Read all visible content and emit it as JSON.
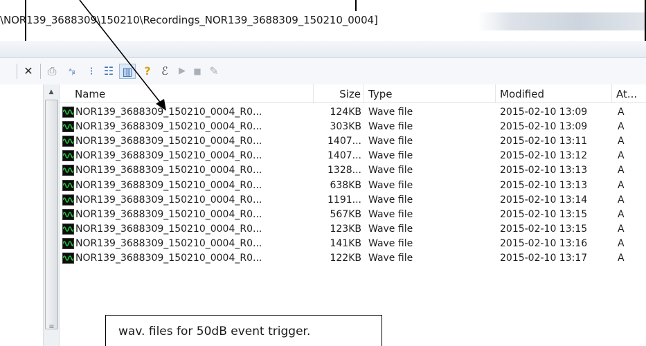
{
  "window": {
    "title_path": "\\NOR139_3688309\\150210\\Recordings_NOR139_3688309_150210_0004]"
  },
  "toolbar": {
    "items": [
      {
        "name": "separator",
        "glyph": "|"
      },
      {
        "name": "delete-icon",
        "glyph": "✕"
      },
      {
        "name": "print-icon",
        "glyph": "⎙"
      },
      {
        "name": "large-icons-view-icon",
        "glyph": "ᵃᵦ"
      },
      {
        "name": "list-view-icon",
        "glyph": "⁝"
      },
      {
        "name": "details-view-icon",
        "glyph": "☷"
      },
      {
        "name": "columns-view-icon",
        "glyph": "▥"
      },
      {
        "name": "help-icon",
        "glyph": "?"
      },
      {
        "name": "find-icon",
        "glyph": "ℰ"
      },
      {
        "name": "play-icon",
        "glyph": "▶"
      },
      {
        "name": "stop-icon",
        "glyph": "■"
      },
      {
        "name": "tools-icon",
        "glyph": "✎"
      }
    ]
  },
  "file_list": {
    "columns": [
      "Name",
      "Size",
      "Type",
      "Modified",
      "At..."
    ],
    "rows": [
      {
        "name": "NOR139_3688309_150210_0004_R0...",
        "size": "124KB",
        "type": "Wave file",
        "modified": "2015-02-10 13:09",
        "attr": "A"
      },
      {
        "name": "NOR139_3688309_150210_0004_R0...",
        "size": "303KB",
        "type": "Wave file",
        "modified": "2015-02-10 13:09",
        "attr": "A"
      },
      {
        "name": "NOR139_3688309_150210_0004_R0...",
        "size": "1407...",
        "type": "Wave file",
        "modified": "2015-02-10 13:11",
        "attr": "A"
      },
      {
        "name": "NOR139_3688309_150210_0004_R0...",
        "size": "1407...",
        "type": "Wave file",
        "modified": "2015-02-10 13:12",
        "attr": "A"
      },
      {
        "name": "NOR139_3688309_150210_0004_R0...",
        "size": "1328...",
        "type": "Wave file",
        "modified": "2015-02-10 13:13",
        "attr": "A"
      },
      {
        "name": "NOR139_3688309_150210_0004_R0...",
        "size": "638KB",
        "type": "Wave file",
        "modified": "2015-02-10 13:13",
        "attr": "A"
      },
      {
        "name": "NOR139_3688309_150210_0004_R0...",
        "size": "1191...",
        "type": "Wave file",
        "modified": "2015-02-10 13:14",
        "attr": "A"
      },
      {
        "name": "NOR139_3688309_150210_0004_R0...",
        "size": "567KB",
        "type": "Wave file",
        "modified": "2015-02-10 13:15",
        "attr": "A"
      },
      {
        "name": "NOR139_3688309_150210_0004_R0...",
        "size": "123KB",
        "type": "Wave file",
        "modified": "2015-02-10 13:15",
        "attr": "A"
      },
      {
        "name": "NOR139_3688309_150210_0004_R0...",
        "size": "141KB",
        "type": "Wave file",
        "modified": "2015-02-10 13:16",
        "attr": "A"
      },
      {
        "name": "NOR139_3688309_150210_0004_R0...",
        "size": "122KB",
        "type": "Wave file",
        "modified": "2015-02-10 13:17",
        "attr": "A"
      }
    ]
  },
  "scrollbar": {
    "up_glyph": "▲",
    "grip_glyph": "≡"
  },
  "annotation": {
    "note": "wav. files for 50dB event trigger."
  },
  "colors": {
    "wave_icon_bg": "#0d0d0d",
    "wave_icon_line": "#22c63a",
    "frame": "#000000"
  }
}
